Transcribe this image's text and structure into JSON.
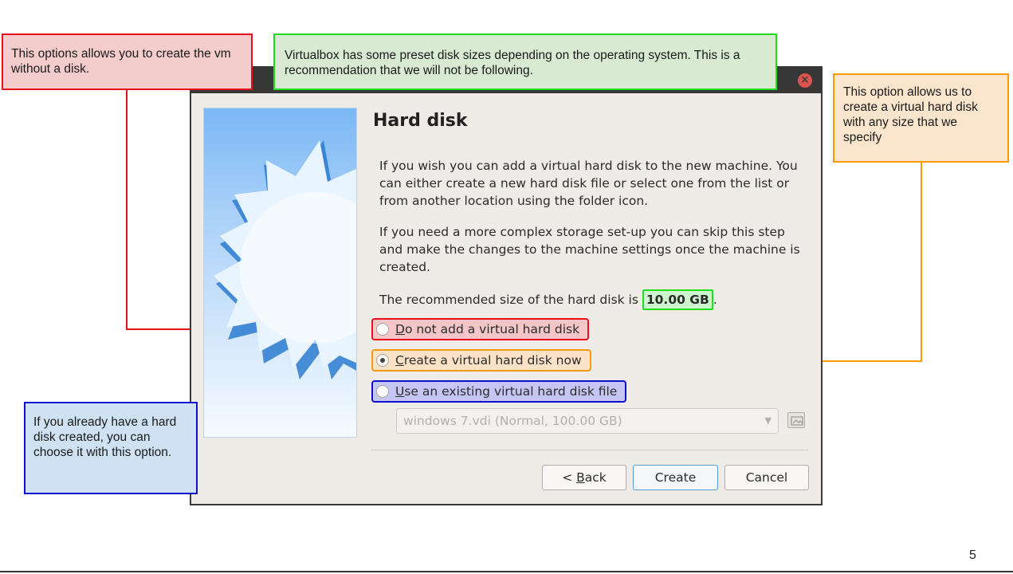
{
  "dialog": {
    "heading": "Hard disk",
    "paragraph_1": "If you wish you can add a virtual hard disk to the new machine. You can either create a new hard disk file or select one from the list or from another location using the folder icon.",
    "paragraph_2": "If you need a more complex storage set-up you can skip this step and make the changes to the machine settings once the machine is created.",
    "recommended_prefix": "The recommended size of the hard disk is ",
    "recommended_size": "10.00 GB",
    "recommended_suffix": ".",
    "options": [
      {
        "mnemonic": "D",
        "rest": "o not add a virtual hard disk",
        "checked": false
      },
      {
        "mnemonic": "C",
        "rest": "reate a virtual hard disk now",
        "checked": true
      },
      {
        "mnemonic": "U",
        "rest": "se an existing virtual hard disk file",
        "checked": false
      }
    ],
    "disk_file_select": "windows 7.vdi (Normal, 100.00 GB)",
    "buttons": {
      "back_prefix": "< ",
      "back_mnemonic": "B",
      "back_rest": "ack",
      "create": "Create",
      "cancel": "Cancel"
    }
  },
  "callouts": {
    "no_disk": "This options allows you to create the vm without a disk.",
    "preset_sizes": "Virtualbox has some preset disk sizes depending on the operating system. This is a recommendation that we will not be following.",
    "create_disk": "This option allows us to create a virtual hard disk with any size that we specify",
    "existing_disk": "If you already have a hard disk created, you can choose it with this option."
  },
  "page_number": "5",
  "colors": {
    "red": "#e8101a",
    "green": "#1ddd1d",
    "orange": "#ff9900",
    "blue": "#1010cc"
  }
}
